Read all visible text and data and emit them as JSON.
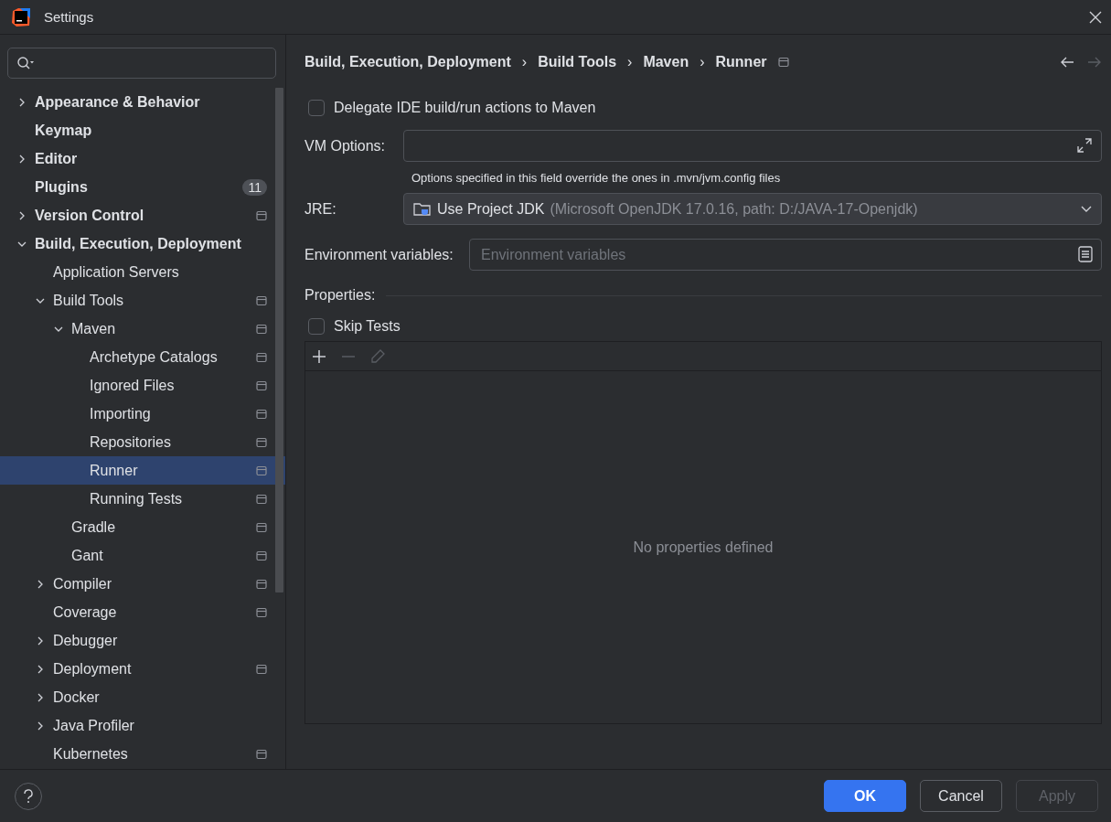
{
  "window": {
    "title": "Settings"
  },
  "sidebar": {
    "items": [
      {
        "label": "Appearance & Behavior",
        "expanded": false,
        "selected": false
      },
      {
        "label": "Keymap",
        "selected": false
      },
      {
        "label": "Editor",
        "expanded": false,
        "selected": false
      },
      {
        "label": "Plugins",
        "badge": "11",
        "selected": false
      },
      {
        "label": "Version Control",
        "expanded": false,
        "project_scoped": true,
        "selected": false
      },
      {
        "label": "Build, Execution, Deployment",
        "expanded": true,
        "selected": false,
        "children": [
          {
            "label": "Application Servers",
            "selected": false
          },
          {
            "label": "Build Tools",
            "expanded": true,
            "project_scoped": true,
            "selected": false,
            "children": [
              {
                "label": "Maven",
                "expanded": true,
                "project_scoped": true,
                "selected": false,
                "children": [
                  {
                    "label": "Archetype Catalogs",
                    "project_scoped": true,
                    "selected": false
                  },
                  {
                    "label": "Ignored Files",
                    "project_scoped": true,
                    "selected": false
                  },
                  {
                    "label": "Importing",
                    "project_scoped": true,
                    "selected": false
                  },
                  {
                    "label": "Repositories",
                    "project_scoped": true,
                    "selected": false
                  },
                  {
                    "label": "Runner",
                    "project_scoped": true,
                    "selected": true
                  },
                  {
                    "label": "Running Tests",
                    "project_scoped": true,
                    "selected": false
                  }
                ]
              },
              {
                "label": "Gradle",
                "project_scoped": true,
                "selected": false
              },
              {
                "label": "Gant",
                "project_scoped": true,
                "selected": false
              }
            ]
          },
          {
            "label": "Compiler",
            "expanded": false,
            "project_scoped": true,
            "selected": false
          },
          {
            "label": "Coverage",
            "project_scoped": true,
            "selected": false
          },
          {
            "label": "Debugger",
            "expanded": false,
            "selected": false
          },
          {
            "label": "Deployment",
            "expanded": false,
            "project_scoped": true,
            "selected": false
          },
          {
            "label": "Docker",
            "expanded": false,
            "selected": false
          },
          {
            "label": "Java Profiler",
            "expanded": false,
            "selected": false
          },
          {
            "label": "Kubernetes",
            "project_scoped": true,
            "selected": false
          }
        ]
      }
    ]
  },
  "breadcrumb": {
    "items": [
      "Build, Execution, Deployment",
      "Build Tools",
      "Maven",
      "Runner"
    ],
    "separator": "›",
    "project_scoped": true
  },
  "delegate": {
    "label": "Delegate IDE build/run actions to Maven",
    "checked": false
  },
  "vm_options": {
    "label": "VM Options:",
    "hint": "Options specified in this field override the ones in .mvn/jvm.config files"
  },
  "jre": {
    "label": "JRE:",
    "value": "Use Project JDK",
    "detail": "(Microsoft OpenJDK 17.0.16, path: D:/JAVA-17-Openjdk)"
  },
  "environment": {
    "label": "Environment variables:",
    "placeholder": "Environment variables"
  },
  "properties": {
    "title": "Properties:",
    "skip_tests": {
      "label": "Skip Tests",
      "checked": false
    },
    "empty_text": "No properties defined"
  },
  "buttons": [
    {
      "label": "OK",
      "kind": "primary",
      "disabled": false
    },
    {
      "label": "Cancel",
      "kind": "default",
      "disabled": false
    },
    {
      "label": "Apply",
      "kind": "default",
      "disabled": true
    }
  ]
}
